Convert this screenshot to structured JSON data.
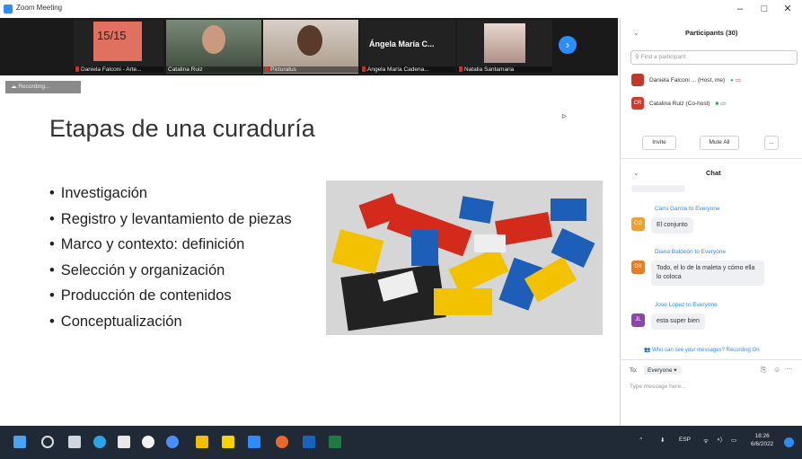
{
  "window": {
    "title": "Zoom Meeting",
    "controls": [
      "–",
      "□",
      "✕"
    ]
  },
  "gallery": {
    "participants": [
      {
        "name": "Daniela Falconi - Arte...",
        "muted": true,
        "tile_text": "15/15"
      },
      {
        "name": "Catalina Ruiz",
        "muted": false
      },
      {
        "name": "Picturatus",
        "muted": true
      },
      {
        "name": "Ángela María Cadena...",
        "muted": true,
        "tile_text": "Ángela María C..."
      },
      {
        "name": "Natalia Santamaria",
        "muted": true
      }
    ],
    "next_icon": "chevron-right-icon"
  },
  "recording": {
    "label": "Recording..."
  },
  "slide": {
    "title": "Etapas de una curaduría",
    "bullets": [
      "Investigación",
      "Registro y levantamiento de piezas",
      "Marco y contexto: definición",
      "Selección y organización",
      "Producción de contenidos",
      "Conceptualización"
    ]
  },
  "participants_panel": {
    "title": "Participants (30)",
    "search_placeholder": "Find a participant",
    "rows": [
      {
        "initials": "",
        "name": "Daniela Falconi ... (Host, me)",
        "avatar_color": "#c0392b"
      },
      {
        "initials": "CR",
        "name": "Catalina Ruiz (Co-host)",
        "avatar_color": "#d13b2e"
      }
    ],
    "invite_label": "Invite",
    "mute_all_label": "Mute All",
    "more_label": "..."
  },
  "chat": {
    "title": "Chat",
    "messages": [
      {
        "from": "Cami Garcia to Everyone",
        "initials": "CG",
        "avatar_color": "#f0a030",
        "text": "El conjunto"
      },
      {
        "from": "Diana Baldeón to Everyone",
        "initials": "DB",
        "avatar_color": "#e87e24",
        "text": "Todo, el lo de la maleta y cómo ella lo coloca"
      },
      {
        "from": "Jose Lopez to Everyone",
        "initials": "JL",
        "avatar_color": "#8e44ad",
        "text": "esta super bien"
      }
    ],
    "privacy_note": "Who can see your messages? Recording On",
    "to_label": "To:",
    "to_value": "Everyone ▾",
    "input_placeholder": "Type message here..."
  },
  "taskbar": {
    "language": "ESP",
    "time": "18:26",
    "date": "6/6/2022",
    "icons": [
      "windows-start-icon",
      "search-icon",
      "task-view-icon",
      "edge-icon",
      "store-icon",
      "chrome-icon",
      "chrome-alt-icon",
      "file-explorer-icon",
      "sticky-notes-icon",
      "zoom-icon",
      "chrome-dev-icon",
      "mail-icon",
      "excel-icon"
    ]
  },
  "colors": {
    "accent": "#2d8cff",
    "taskbar": "#1f2a36",
    "gallery_bg": "#1a1a1a"
  }
}
